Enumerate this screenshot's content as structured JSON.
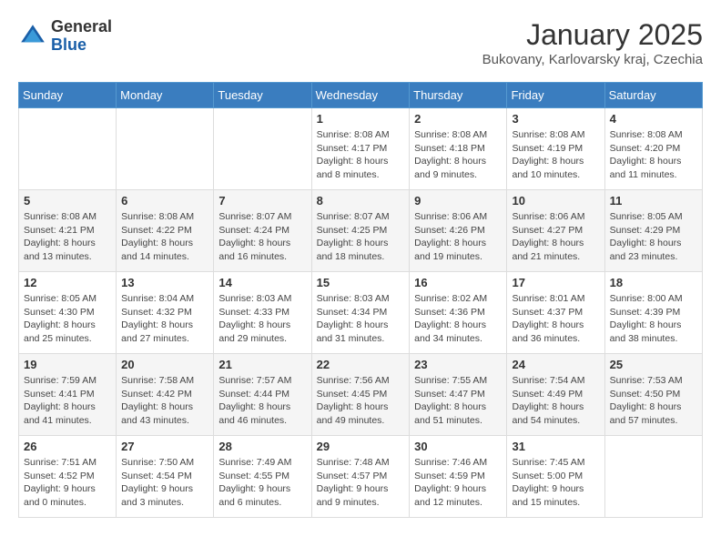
{
  "logo": {
    "general": "General",
    "blue": "Blue"
  },
  "title": "January 2025",
  "location": "Bukovany, Karlovarsky kraj, Czechia",
  "weekdays": [
    "Sunday",
    "Monday",
    "Tuesday",
    "Wednesday",
    "Thursday",
    "Friday",
    "Saturday"
  ],
  "weeks": [
    [
      {
        "day": null,
        "info": ""
      },
      {
        "day": null,
        "info": ""
      },
      {
        "day": null,
        "info": ""
      },
      {
        "day": "1",
        "info": "Sunrise: 8:08 AM\nSunset: 4:17 PM\nDaylight: 8 hours and 8 minutes."
      },
      {
        "day": "2",
        "info": "Sunrise: 8:08 AM\nSunset: 4:18 PM\nDaylight: 8 hours and 9 minutes."
      },
      {
        "day": "3",
        "info": "Sunrise: 8:08 AM\nSunset: 4:19 PM\nDaylight: 8 hours and 10 minutes."
      },
      {
        "day": "4",
        "info": "Sunrise: 8:08 AM\nSunset: 4:20 PM\nDaylight: 8 hours and 11 minutes."
      }
    ],
    [
      {
        "day": "5",
        "info": "Sunrise: 8:08 AM\nSunset: 4:21 PM\nDaylight: 8 hours and 13 minutes."
      },
      {
        "day": "6",
        "info": "Sunrise: 8:08 AM\nSunset: 4:22 PM\nDaylight: 8 hours and 14 minutes."
      },
      {
        "day": "7",
        "info": "Sunrise: 8:07 AM\nSunset: 4:24 PM\nDaylight: 8 hours and 16 minutes."
      },
      {
        "day": "8",
        "info": "Sunrise: 8:07 AM\nSunset: 4:25 PM\nDaylight: 8 hours and 18 minutes."
      },
      {
        "day": "9",
        "info": "Sunrise: 8:06 AM\nSunset: 4:26 PM\nDaylight: 8 hours and 19 minutes."
      },
      {
        "day": "10",
        "info": "Sunrise: 8:06 AM\nSunset: 4:27 PM\nDaylight: 8 hours and 21 minutes."
      },
      {
        "day": "11",
        "info": "Sunrise: 8:05 AM\nSunset: 4:29 PM\nDaylight: 8 hours and 23 minutes."
      }
    ],
    [
      {
        "day": "12",
        "info": "Sunrise: 8:05 AM\nSunset: 4:30 PM\nDaylight: 8 hours and 25 minutes."
      },
      {
        "day": "13",
        "info": "Sunrise: 8:04 AM\nSunset: 4:32 PM\nDaylight: 8 hours and 27 minutes."
      },
      {
        "day": "14",
        "info": "Sunrise: 8:03 AM\nSunset: 4:33 PM\nDaylight: 8 hours and 29 minutes."
      },
      {
        "day": "15",
        "info": "Sunrise: 8:03 AM\nSunset: 4:34 PM\nDaylight: 8 hours and 31 minutes."
      },
      {
        "day": "16",
        "info": "Sunrise: 8:02 AM\nSunset: 4:36 PM\nDaylight: 8 hours and 34 minutes."
      },
      {
        "day": "17",
        "info": "Sunrise: 8:01 AM\nSunset: 4:37 PM\nDaylight: 8 hours and 36 minutes."
      },
      {
        "day": "18",
        "info": "Sunrise: 8:00 AM\nSunset: 4:39 PM\nDaylight: 8 hours and 38 minutes."
      }
    ],
    [
      {
        "day": "19",
        "info": "Sunrise: 7:59 AM\nSunset: 4:41 PM\nDaylight: 8 hours and 41 minutes."
      },
      {
        "day": "20",
        "info": "Sunrise: 7:58 AM\nSunset: 4:42 PM\nDaylight: 8 hours and 43 minutes."
      },
      {
        "day": "21",
        "info": "Sunrise: 7:57 AM\nSunset: 4:44 PM\nDaylight: 8 hours and 46 minutes."
      },
      {
        "day": "22",
        "info": "Sunrise: 7:56 AM\nSunset: 4:45 PM\nDaylight: 8 hours and 49 minutes."
      },
      {
        "day": "23",
        "info": "Sunrise: 7:55 AM\nSunset: 4:47 PM\nDaylight: 8 hours and 51 minutes."
      },
      {
        "day": "24",
        "info": "Sunrise: 7:54 AM\nSunset: 4:49 PM\nDaylight: 8 hours and 54 minutes."
      },
      {
        "day": "25",
        "info": "Sunrise: 7:53 AM\nSunset: 4:50 PM\nDaylight: 8 hours and 57 minutes."
      }
    ],
    [
      {
        "day": "26",
        "info": "Sunrise: 7:51 AM\nSunset: 4:52 PM\nDaylight: 9 hours and 0 minutes."
      },
      {
        "day": "27",
        "info": "Sunrise: 7:50 AM\nSunset: 4:54 PM\nDaylight: 9 hours and 3 minutes."
      },
      {
        "day": "28",
        "info": "Sunrise: 7:49 AM\nSunset: 4:55 PM\nDaylight: 9 hours and 6 minutes."
      },
      {
        "day": "29",
        "info": "Sunrise: 7:48 AM\nSunset: 4:57 PM\nDaylight: 9 hours and 9 minutes."
      },
      {
        "day": "30",
        "info": "Sunrise: 7:46 AM\nSunset: 4:59 PM\nDaylight: 9 hours and 12 minutes."
      },
      {
        "day": "31",
        "info": "Sunrise: 7:45 AM\nSunset: 5:00 PM\nDaylight: 9 hours and 15 minutes."
      },
      {
        "day": null,
        "info": ""
      }
    ]
  ]
}
